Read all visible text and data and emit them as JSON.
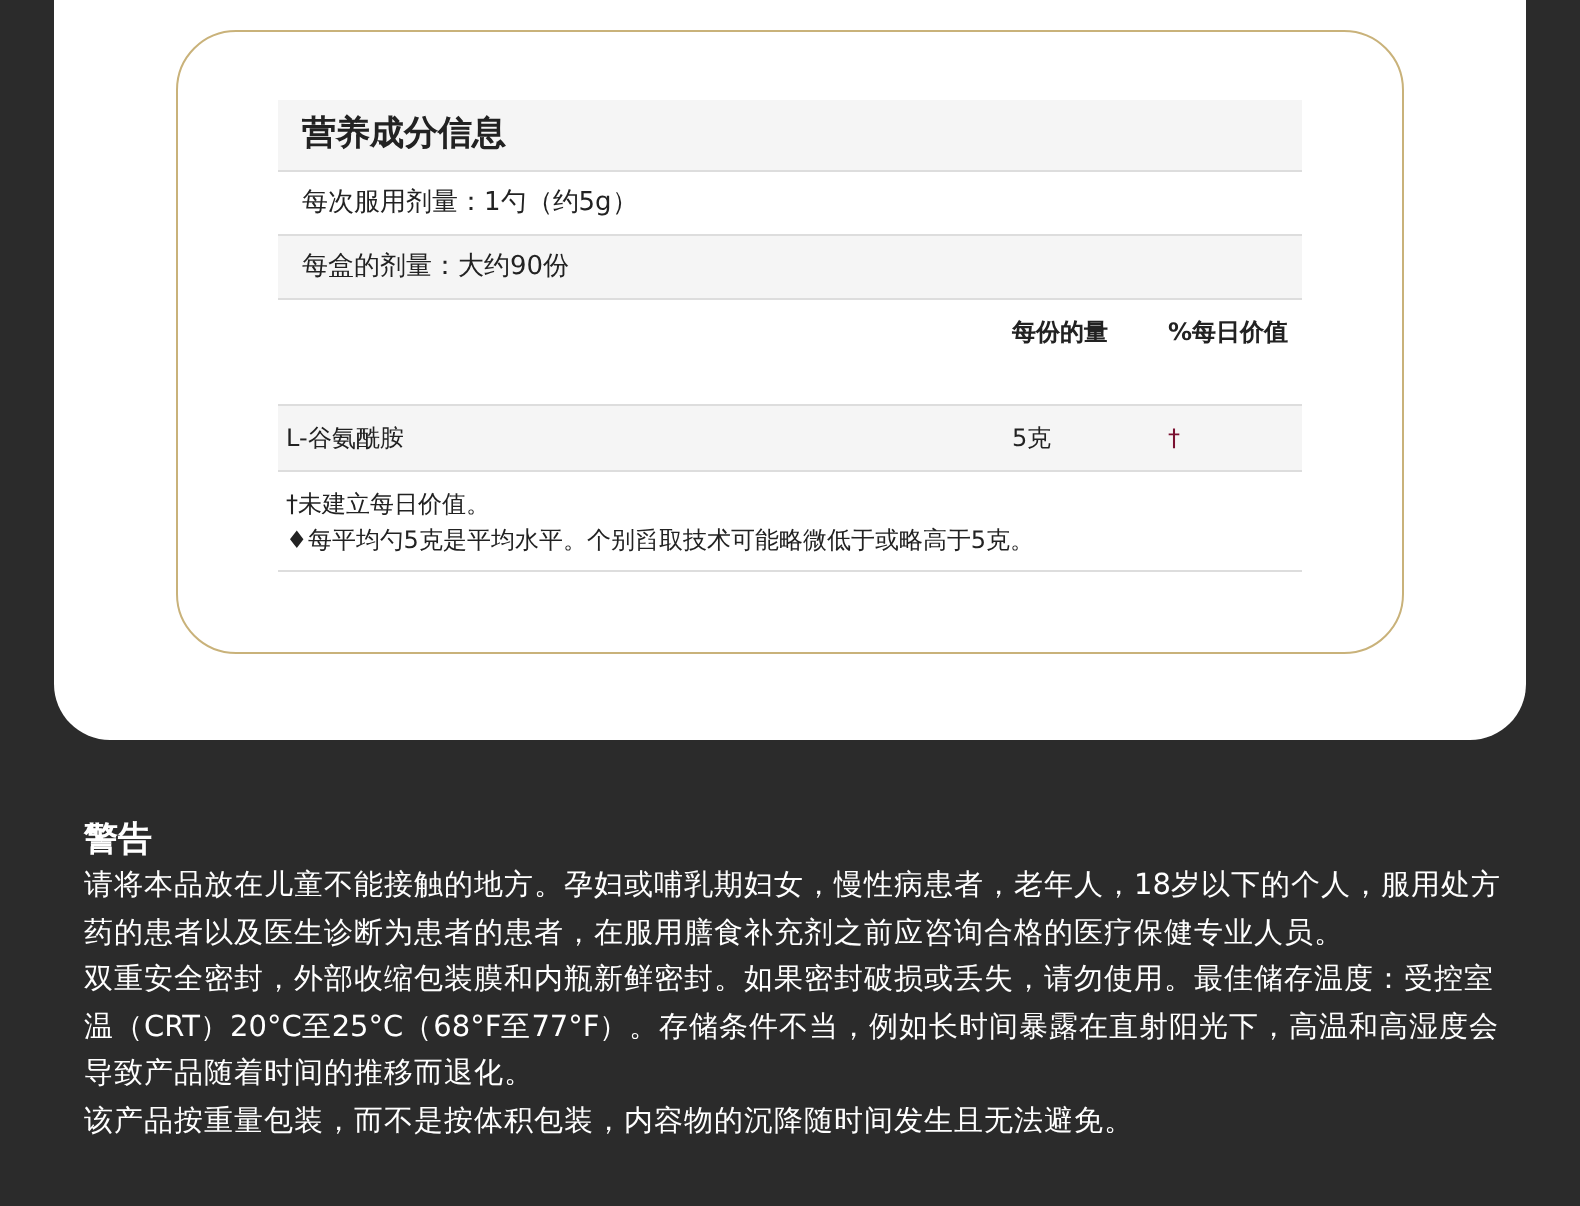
{
  "nutrition": {
    "title": "营养成分信息",
    "serving_size": "每次服用剂量：1勺（约5g）",
    "servings_per_container": "每盒的剂量：大约90份",
    "columns": [
      "每份的量",
      "%每日价值"
    ],
    "rows": [
      {
        "name": "L-谷氨酰胺",
        "amount": "5克",
        "daily_value": "†"
      }
    ],
    "footnotes": [
      "†未建立每日价值。",
      "♦每平均勺5克是平均水平。个别舀取技术可能略微低于或略高于5克。"
    ]
  },
  "warning": {
    "title": "警告",
    "paragraphs": [
      "请将本品放在儿童不能接触的地方。孕妇或哺乳期妇女，慢性病患者，老年人，18岁以下的个人，服用处方药的患者以及医生诊断为患者的患者，在服用膳食补充剂之前应咨询合格的医疗保健专业人员。",
      "双重安全密封，外部收缩包装膜和内瓶新鲜密封。如果密封破损或丢失，请勿使用。最佳储存温度：受控室温（CRT）20°C至25°C（68°F至77°F）。存储条件不当，例如长时间暴露在直射阳光下，高温和高湿度会导致产品随着时间的推移而退化。",
      "该产品按重量包装，而不是按体积包装，内容物的沉降随时间发生且无法避免。"
    ]
  }
}
